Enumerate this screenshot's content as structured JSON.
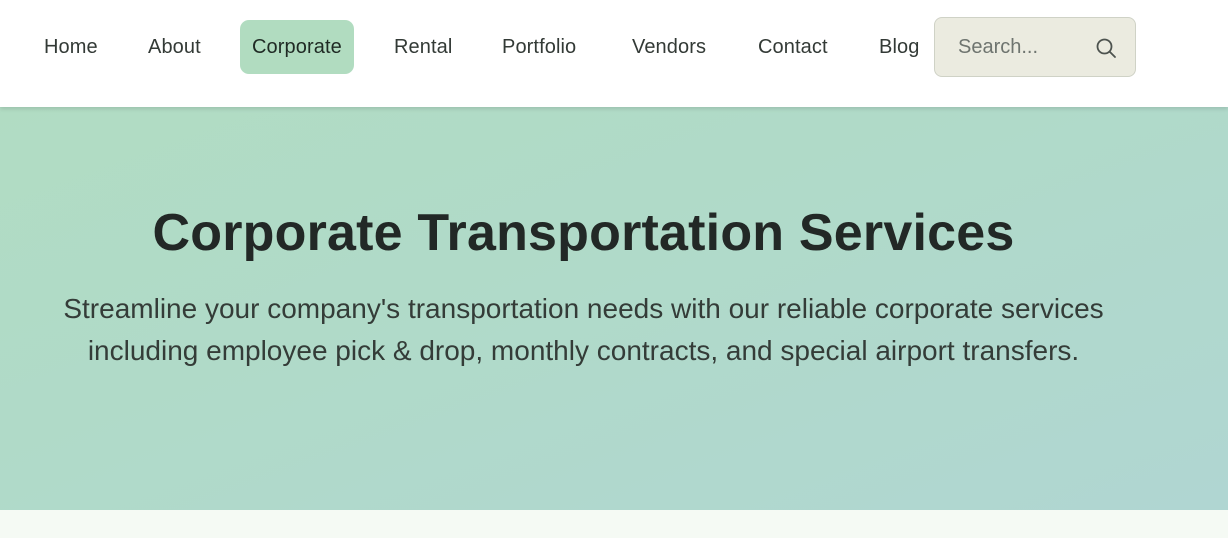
{
  "nav": {
    "items": [
      {
        "label": "Home",
        "active": false
      },
      {
        "label": "About",
        "active": false
      },
      {
        "label": "Corporate",
        "active": true
      },
      {
        "label": "Rental",
        "active": false
      },
      {
        "label": "Portfolio",
        "active": false
      },
      {
        "label": "Vendors",
        "active": false
      },
      {
        "label": "Contact",
        "active": false
      },
      {
        "label": "Blog",
        "active": false
      }
    ],
    "search": {
      "placeholder": "Search...",
      "value": "",
      "icon": "search-icon"
    }
  },
  "hero": {
    "title": "Corporate Transportation Services",
    "subtitle": "Streamline your company's transportation needs with our reliable corporate services including employee pick & drop, monthly contracts, and special airport transfers."
  },
  "colors": {
    "active_nav_bg": "#b1dcc0",
    "hero_gradient_start": "#b1dcc3",
    "hero_gradient_end": "#b0d6d2",
    "search_bg": "#ebebe0",
    "text_dark": "#222826"
  }
}
